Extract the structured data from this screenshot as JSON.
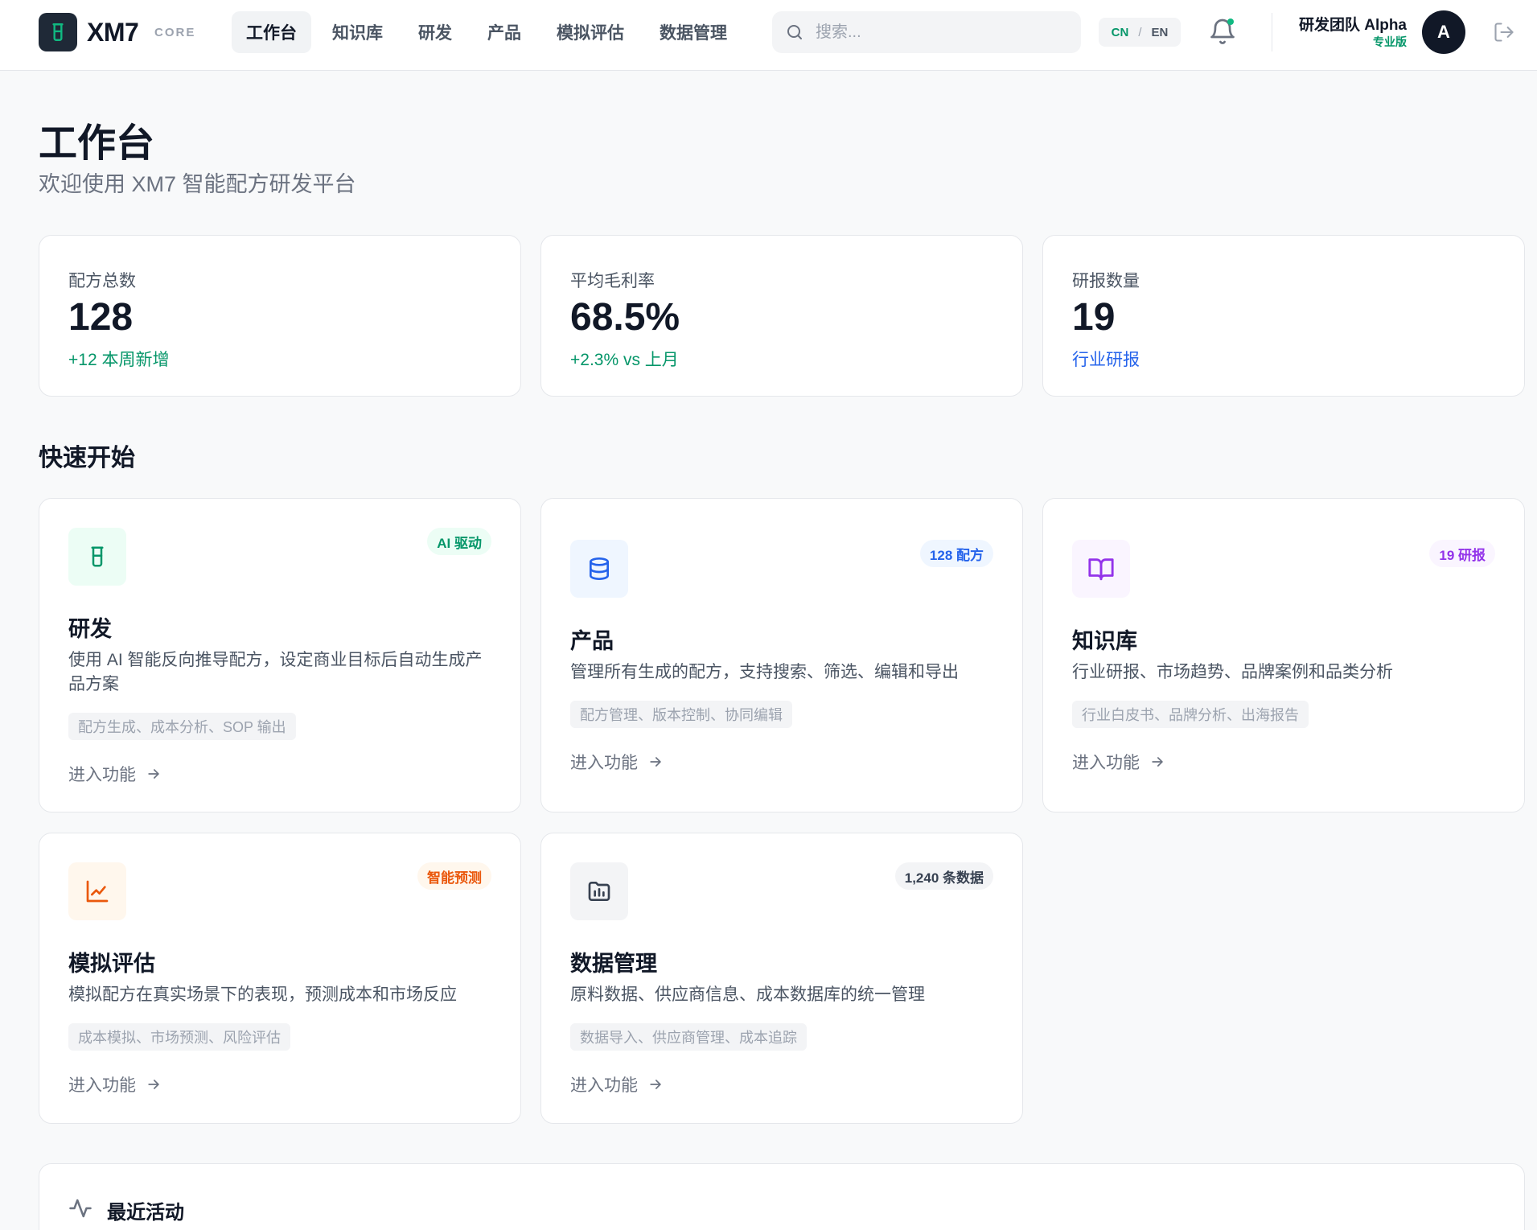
{
  "header": {
    "brand": "XM7",
    "brand_sub": "CORE",
    "nav": [
      "工作台",
      "知识库",
      "研发",
      "产品",
      "模拟评估",
      "数据管理"
    ],
    "search_placeholder": "搜索...",
    "lang_cn": "CN",
    "lang_sep": "/",
    "lang_en": "EN",
    "team_name": "研发团队 Alpha",
    "team_plan": "专业版",
    "avatar_initial": "A"
  },
  "page": {
    "title": "工作台",
    "subtitle": "欢迎使用 XM7 智能配方研发平台"
  },
  "stats": [
    {
      "label": "配方总数",
      "value": "128",
      "note": "+12 本周新增",
      "note_color": "#059669"
    },
    {
      "label": "平均毛利率",
      "value": "68.5%",
      "note": "+2.3% vs 上月",
      "note_color": "#059669"
    },
    {
      "label": "研报数量",
      "value": "19",
      "note": "行业研报",
      "note_color": "#2563eb"
    }
  ],
  "quick_start": {
    "title": "快速开始",
    "cards": [
      {
        "title": "研发",
        "badge": "AI 驱动",
        "desc": "使用 AI 智能反向推导配方，设定商业目标后自动生成产品方案",
        "tags": "配方生成、成本分析、SOP 输出",
        "link": "进入功能",
        "icon": "beaker-icon",
        "accent": "#059669"
      },
      {
        "title": "产品",
        "badge": "128 配方",
        "desc": "管理所有生成的配方，支持搜索、筛选、编辑和导出",
        "tags": "配方管理、版本控制、协同编辑",
        "link": "进入功能",
        "icon": "database-icon",
        "accent": "#2563eb"
      },
      {
        "title": "知识库",
        "badge": "19 研报",
        "desc": "行业研报、市场趋势、品牌案例和品类分析",
        "tags": "行业白皮书、品牌分析、出海报告",
        "link": "进入功能",
        "icon": "book-icon",
        "accent": "#9333ea"
      },
      {
        "title": "模拟评估",
        "badge": "智能预测",
        "desc": "模拟配方在真实场景下的表现，预测成本和市场反应",
        "tags": "成本模拟、市场预测、风险评估",
        "link": "进入功能",
        "icon": "line-chart-icon",
        "accent": "#ea580c"
      },
      {
        "title": "数据管理",
        "badge": "1,240 条数据",
        "desc": "原料数据、供应商信息、成本数据库的统一管理",
        "tags": "数据导入、供应商管理、成本追踪",
        "link": "进入功能",
        "icon": "folder-chart-icon",
        "accent": "#374151"
      }
    ]
  },
  "activity": {
    "title": "最近活动"
  }
}
